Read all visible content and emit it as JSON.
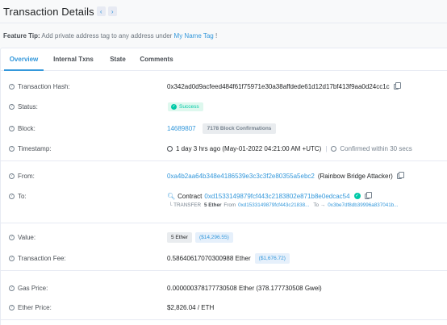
{
  "header": {
    "title": "Transaction Details",
    "prev_glyph": "‹",
    "next_glyph": "›"
  },
  "feature_tip": {
    "label": "Feature Tip:",
    "text": "Add private address tag to any address under",
    "link": "My Name Tag",
    "suffix": "!"
  },
  "tabs": [
    "Overview",
    "Internal Txns",
    "State",
    "Comments"
  ],
  "rows": {
    "hash": {
      "label": "Transaction Hash:",
      "value": "0x342ad0d9acfeed484f61f75971e30a38affdede61d12d17bf413f9aa0d24cc1c"
    },
    "status": {
      "label": "Status:",
      "value": "Success"
    },
    "block": {
      "label": "Block:",
      "number": "14689807",
      "confirmations": "7178 Block Confirmations"
    },
    "timestamp": {
      "label": "Timestamp:",
      "value": "1 day 3 hrs ago (May-01-2022 04:21:00 AM +UTC)",
      "confirmed": "Confirmed within 30 secs"
    },
    "from": {
      "label": "From:",
      "address": "0xa4b2aa64b348e4186539e3c3c3f2e80355a5ebc2",
      "tag": "(Rainbow Bridge Attacker)"
    },
    "to": {
      "label": "To:",
      "prefix": "Contract",
      "address": "0xd1533149879fcf443c2183802e871b8e0edcac54",
      "transfer": {
        "prefix": "└ TRANSFER",
        "amount": "5 Ether",
        "from_label": "From",
        "from_addr": "0xd1533149879fcf443c21838...",
        "to_label": "To",
        "arrow": "→",
        "to_addr": "0x3be7df8db39996a837041b..."
      }
    },
    "value": {
      "label": "Value:",
      "ether": "5 Ether",
      "usd": "($14,296.55)"
    },
    "fee": {
      "label": "Transaction Fee:",
      "ether": "0.58640617070300988 Ether",
      "usd": "($1,676.72)"
    },
    "gas_price": {
      "label": "Gas Price:",
      "value": "0.000000378177730508 Ether (378.177730508 Gwei)"
    },
    "ether_price": {
      "label": "Ether Price:",
      "value": "$2,826.04 / ETH"
    }
  },
  "colors": {
    "accent": "#3498db",
    "success": "#00c9a7",
    "text": "#1e2022",
    "muted": "#77838f"
  }
}
